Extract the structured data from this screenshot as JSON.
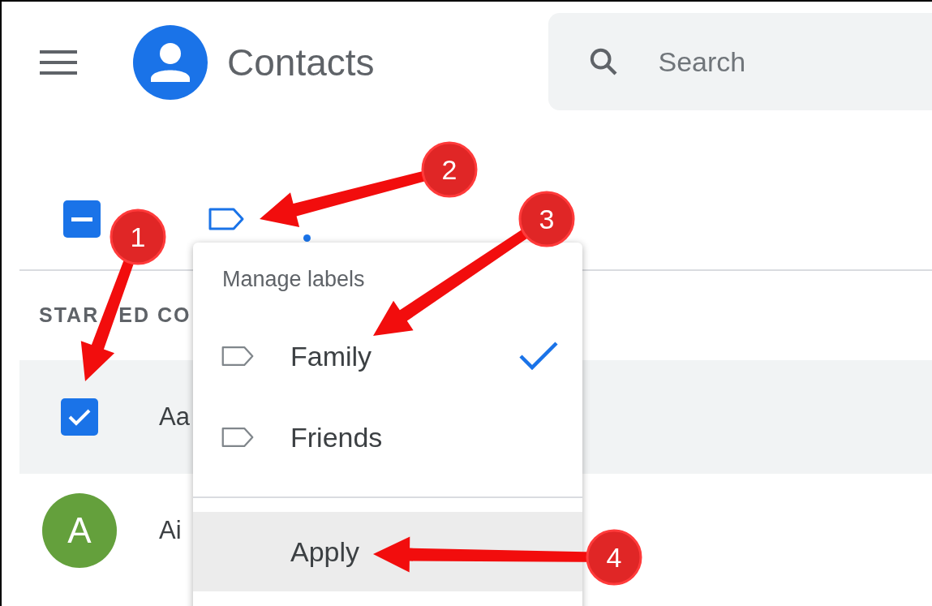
{
  "header": {
    "app_title": "Contacts",
    "search": {
      "placeholder": "Search"
    }
  },
  "toolbar": {
    "select_all": {
      "indeterminate": true
    },
    "label_button": {
      "has_dot": true
    }
  },
  "section_title_parts": [
    "STAR",
    "ED CO"
  ],
  "contacts": [
    {
      "kind": "checkbox",
      "name": "Aa",
      "checked": true,
      "selected": true
    },
    {
      "kind": "avatar",
      "initial": "A",
      "color": "#64a03c",
      "name": "Ai",
      "selected": false
    }
  ],
  "menu": {
    "title": "Manage labels",
    "labels": [
      {
        "name": "Family",
        "checked": true
      },
      {
        "name": "Friends",
        "checked": false
      }
    ],
    "apply": {
      "label": "Apply",
      "highlighted": true
    }
  },
  "annotations": [
    {
      "number": "1"
    },
    {
      "number": "2"
    },
    {
      "number": "3"
    },
    {
      "number": "4"
    }
  ]
}
